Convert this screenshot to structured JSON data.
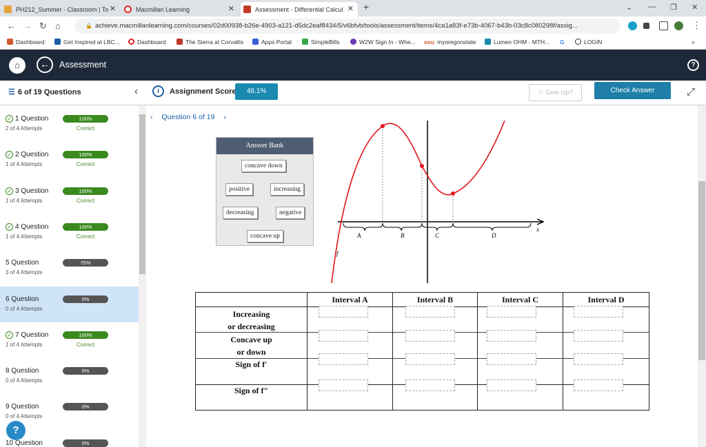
{
  "browser": {
    "tabs": [
      {
        "title": "PH212_Summer - Classroom | To",
        "icon": "t-icon",
        "color": "#e8a23a"
      },
      {
        "title": "Macmillan Learning",
        "icon": "macmillan-icon",
        "color": "#d22"
      },
      {
        "title": "Assessment - Differential Calcul",
        "icon": "assessment-icon",
        "color": "#c0392b"
      }
    ],
    "url": "achieve.macmillanlearning.com/courses/02d00938-b26e-4903-a121-d5dc2eaf8434/5/v6bfvb/tools/assessment/items/4ca1a83f-e73b-4067-b43b-03c8c080298f/assig...",
    "bookmarks": [
      "Dashboard",
      "Get Inspired at LBC...",
      "Dashboard",
      "The Sierra at Corvallis",
      "Apps Portal",
      "SimpleBills",
      "W2W Sign In - Whe...",
      "myoregonstate",
      "Lumen OHM - MTH...",
      "G",
      "LOGIN"
    ],
    "bookmark_prefix": {
      "osu": "osu"
    }
  },
  "app": {
    "title": "Assessment",
    "question_count": "6 of 19 Questions",
    "score_label": "Assignment Score:",
    "score_value": "46.1%",
    "give_up": "Give Up?",
    "check_answer": "Check Answer",
    "help": "?"
  },
  "sidebar": {
    "questions": [
      {
        "title": "1 Question",
        "attempts": "2 of 4 Attempts",
        "badge": "100%",
        "status": "Correct",
        "done": true,
        "color": "#3a8a1e"
      },
      {
        "title": "2 Question",
        "attempts": "1 of 4 Attempts",
        "badge": "100%",
        "status": "Correct",
        "done": true,
        "color": "#3a8a1e"
      },
      {
        "title": "3 Question",
        "attempts": "1 of 4 Attempts",
        "badge": "100%",
        "status": "Correct",
        "done": true,
        "color": "#3a8a1e"
      },
      {
        "title": "4 Question",
        "attempts": "1 of 4 Attempts",
        "badge": "100%",
        "status": "Correct",
        "done": true,
        "color": "#3a8a1e"
      },
      {
        "title": "5 Question",
        "attempts": "3 of 4 Attempts",
        "badge": "75%",
        "status": "",
        "done": false,
        "color": "#555"
      },
      {
        "title": "6 Question",
        "attempts": "0 of 4 Attempts",
        "badge": "0%",
        "status": "",
        "done": false,
        "color": "#555",
        "active": true
      },
      {
        "title": "7 Question",
        "attempts": "1 of 4 Attempts",
        "badge": "100%",
        "status": "Correct",
        "done": true,
        "color": "#3a8a1e"
      },
      {
        "title": "8 Question",
        "attempts": "0 of 4 Attempts",
        "badge": "0%",
        "status": "",
        "done": false,
        "color": "#555"
      },
      {
        "title": "9 Question",
        "attempts": "0 of 4 Attempts",
        "badge": "0%",
        "status": "",
        "done": false,
        "color": "#555"
      },
      {
        "title": "10 Question",
        "attempts": "",
        "badge": "0%",
        "status": "",
        "done": false,
        "color": "#555"
      }
    ]
  },
  "question": {
    "nav": "Question 6 of 19",
    "answer_bank_title": "Answer Bank",
    "answer_bank": [
      "concave down",
      "positive",
      "increasing",
      "decreasing",
      "negative",
      "concave up"
    ],
    "graph_labels": {
      "A": "A",
      "B": "B",
      "C": "C",
      "D": "D",
      "x": "x",
      "f": "f"
    },
    "table": {
      "headers": [
        "Interval A",
        "Interval B",
        "Interval C",
        "Interval D"
      ],
      "rows": [
        [
          "Increasing",
          "or decreasing"
        ],
        [
          "Concave up",
          "or down"
        ],
        [
          "Sign of f′"
        ],
        [
          "Sign of f″"
        ]
      ]
    }
  }
}
